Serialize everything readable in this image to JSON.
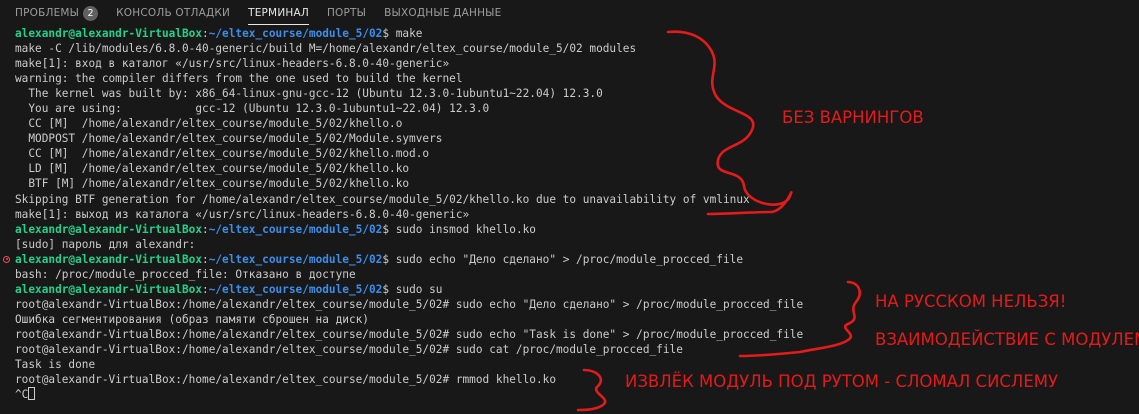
{
  "panel": {
    "tabs": [
      {
        "label": "ПРОБЛЕМЫ",
        "badge": "2"
      },
      {
        "label": "КОНСОЛЬ ОТЛАДКИ"
      },
      {
        "label": "ТЕРМИНАЛ"
      },
      {
        "label": "ПОРТЫ"
      },
      {
        "label": "ВЫХОДНЫЕ ДАННЫЕ"
      }
    ],
    "active_tab": "ТЕРМИНАЛ"
  },
  "terminal": {
    "lines": [
      {
        "prompt_user": "alexandr@alexandr-VirtualBox",
        "prompt_sep": ":",
        "prompt_path": "~/eltex_course/module_5/02",
        "prompt_end": "$ ",
        "text": "make"
      },
      {
        "text": "make -C /lib/modules/6.8.0-40-generic/build M=/home/alexandr/eltex_course/module_5/02 modules"
      },
      {
        "text": "make[1]: вход в каталог «/usr/src/linux-headers-6.8.0-40-generic»"
      },
      {
        "text": "warning: the compiler differs from the one used to build the kernel"
      },
      {
        "text": "  The kernel was built by: x86_64-linux-gnu-gcc-12 (Ubuntu 12.3.0-1ubuntu1~22.04) 12.3.0"
      },
      {
        "text": "  You are using:           gcc-12 (Ubuntu 12.3.0-1ubuntu1~22.04) 12.3.0"
      },
      {
        "text": "  CC [M]  /home/alexandr/eltex_course/module_5/02/khello.o"
      },
      {
        "text": "  MODPOST /home/alexandr/eltex_course/module_5/02/Module.symvers"
      },
      {
        "text": "  CC [M]  /home/alexandr/eltex_course/module_5/02/khello.mod.o"
      },
      {
        "text": "  LD [M]  /home/alexandr/eltex_course/module_5/02/khello.ko"
      },
      {
        "text": "  BTF [M] /home/alexandr/eltex_course/module_5/02/khello.ko"
      },
      {
        "text": "Skipping BTF generation for /home/alexandr/eltex_course/module_5/02/khello.ko due to unavailability of vmlinux"
      },
      {
        "text": "make[1]: выход из каталога «/usr/src/linux-headers-6.8.0-40-generic»"
      },
      {
        "prompt_user": "alexandr@alexandr-VirtualBox",
        "prompt_sep": ":",
        "prompt_path": "~/eltex_course/module_5/02",
        "prompt_end": "$ ",
        "text": "sudo insmod khello.ko"
      },
      {
        "text": "[sudo] пароль для alexandr:"
      },
      {
        "error": true,
        "prompt_user": "alexandr@alexandr-VirtualBox",
        "prompt_sep": ":",
        "prompt_path": "~/eltex_course/module_5/02",
        "prompt_end": "$ ",
        "text": "sudo echo \"Дело сделано\" > /proc/module_procced_file"
      },
      {
        "text": "bash: /proc/module_procced_file: Отказано в доступе"
      },
      {
        "prompt_user": "alexandr@alexandr-VirtualBox",
        "prompt_sep": ":",
        "prompt_path": "~/eltex_course/module_5/02",
        "prompt_end": "$ ",
        "text": "sudo su"
      },
      {
        "text": "root@alexandr-VirtualBox:/home/alexandr/eltex_course/module_5/02# sudo echo \"Дело сделано\" > /proc/module_procced_file"
      },
      {
        "text": "Ошибка сегментирования (образ памяти сброшен на диск)"
      },
      {
        "text": "root@alexandr-VirtualBox:/home/alexandr/eltex_course/module_5/02# sudo echo \"Task is done\" > /proc/module_procced_file"
      },
      {
        "text": "root@alexandr-VirtualBox:/home/alexandr/eltex_course/module_5/02# sudo cat /proc/module_procced_file"
      },
      {
        "text": "Task is done"
      },
      {
        "text": "root@alexandr-VirtualBox:/home/alexandr/eltex_course/module_5/02# rmmod khello.ko"
      },
      {
        "text": "^C",
        "cursor": true
      }
    ]
  },
  "annotations": {
    "note1": "БЕЗ ВАРНИНГОВ",
    "note2": "НА РУССКОМ НЕЛЬЗЯ!",
    "note3": "ВЗАИМОДЕЙСТВИЕ С МОДУЛЕМ",
    "note4": "ИЗВЛЁК МОДУЛЬ ПОД РУТОМ - СЛОМАЛ СИСЛЕМУ",
    "color": "#e51b1b"
  },
  "colors": {
    "background": "#181818",
    "text": "#cccccc",
    "prompt_user": "#23d18b",
    "prompt_path": "#3b8eea",
    "error_marker": "#f14c4c"
  }
}
